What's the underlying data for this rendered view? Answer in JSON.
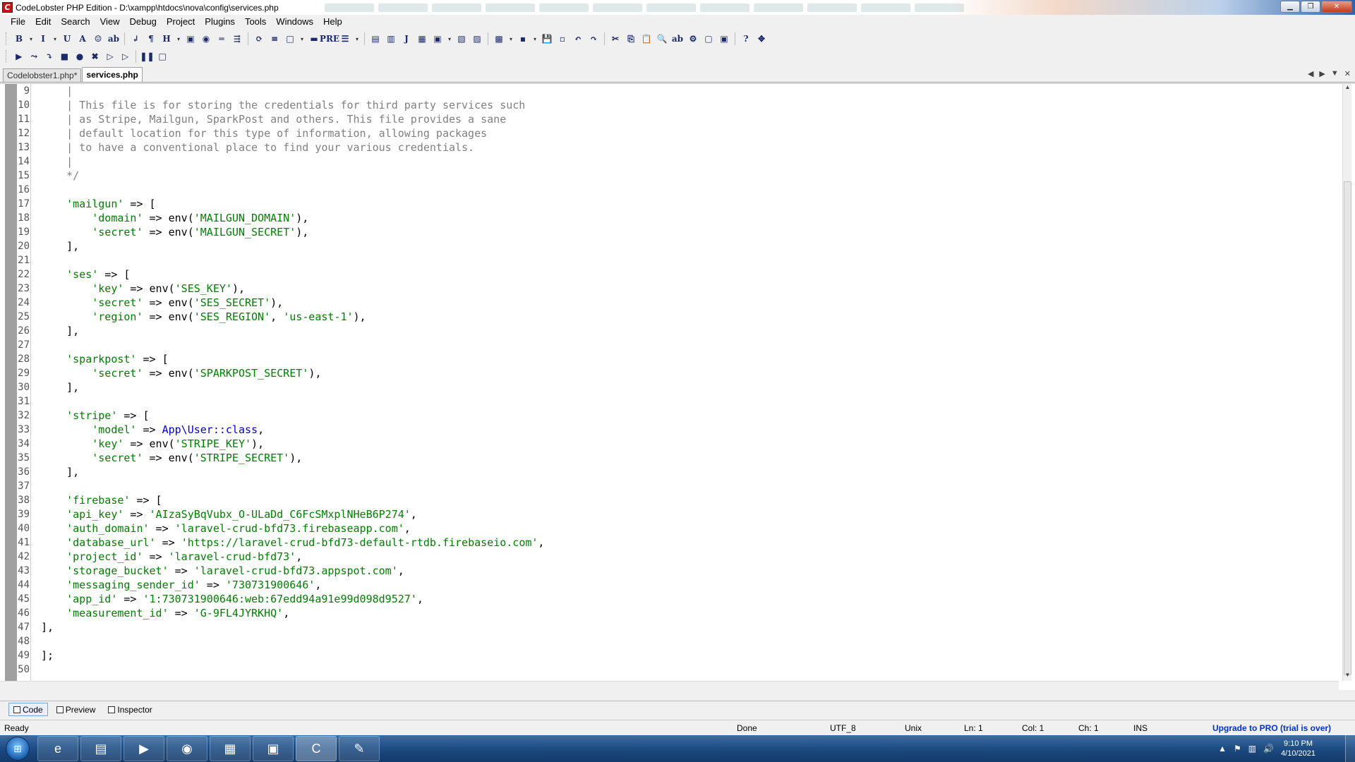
{
  "window": {
    "title": "CodeLobster PHP Edition - D:\\xampp\\htdocs\\nova\\config\\services.php",
    "app_icon": "C",
    "minimize": "▁",
    "maximize": "❐",
    "close": "✕"
  },
  "menu": [
    "File",
    "Edit",
    "Search",
    "View",
    "Debug",
    "Project",
    "Plugins",
    "Tools",
    "Windows",
    "Help"
  ],
  "toolbar1": [
    "B",
    "▾",
    "I",
    "▾",
    "U",
    "A",
    "☺",
    "ab",
    "↲",
    "¶",
    "H",
    "▾",
    "▣",
    "◉",
    "═",
    "⇶",
    "⟳",
    "≡",
    "□",
    "▾",
    "▬",
    "PRE",
    "☰",
    "▾",
    "▤",
    "▥",
    "J",
    "▦",
    "▣",
    "▾",
    "▧",
    "▨",
    "▩",
    "▾",
    "▪",
    "▾",
    "💾",
    "▫",
    "↶",
    "↷",
    "✂",
    "⎘",
    "📋",
    "🔍",
    "ab",
    "⚙",
    "▢",
    "▣",
    "?",
    "✥"
  ],
  "toolbar2": [
    "▶",
    "⤳",
    "⤵",
    "■",
    "●",
    "✖",
    "▷",
    "▷",
    "❚❚",
    "□"
  ],
  "tabs": {
    "items": [
      {
        "label": "Codelobster1.php*",
        "active": false
      },
      {
        "label": "services.php",
        "active": true
      }
    ],
    "nav_prev": "◀",
    "nav_next": "▶",
    "nav_list": "▼",
    "nav_close": "✕"
  },
  "code_lines": [
    {
      "n": "9",
      "parts": [
        {
          "t": "    |",
          "c": "cm"
        }
      ]
    },
    {
      "n": "10",
      "parts": [
        {
          "t": "    | This file is for storing the credentials for third party services such",
          "c": "cm"
        }
      ]
    },
    {
      "n": "11",
      "parts": [
        {
          "t": "    | as Stripe, Mailgun, SparkPost and others. This file provides a sane",
          "c": "cm"
        }
      ]
    },
    {
      "n": "12",
      "parts": [
        {
          "t": "    | default location for this type of information, allowing packages",
          "c": "cm"
        }
      ]
    },
    {
      "n": "13",
      "parts": [
        {
          "t": "    | to have a conventional place to find your various credentials.",
          "c": "cm"
        }
      ]
    },
    {
      "n": "14",
      "parts": [
        {
          "t": "    |",
          "c": "cm"
        }
      ]
    },
    {
      "n": "15",
      "parts": [
        {
          "t": "    */",
          "c": "cm"
        }
      ]
    },
    {
      "n": "16",
      "parts": []
    },
    {
      "n": "17",
      "parts": [
        {
          "t": "    ",
          "c": "op"
        },
        {
          "t": "'mailgun'",
          "c": "st"
        },
        {
          "t": " => [",
          "c": "op"
        }
      ]
    },
    {
      "n": "18",
      "parts": [
        {
          "t": "        ",
          "c": "op"
        },
        {
          "t": "'domain'",
          "c": "st"
        },
        {
          "t": " => env(",
          "c": "op"
        },
        {
          "t": "'MAILGUN_DOMAIN'",
          "c": "st"
        },
        {
          "t": "),",
          "c": "op"
        }
      ]
    },
    {
      "n": "19",
      "parts": [
        {
          "t": "        ",
          "c": "op"
        },
        {
          "t": "'secret'",
          "c": "st"
        },
        {
          "t": " => env(",
          "c": "op"
        },
        {
          "t": "'MAILGUN_SECRET'",
          "c": "st"
        },
        {
          "t": "),",
          "c": "op"
        }
      ]
    },
    {
      "n": "20",
      "parts": [
        {
          "t": "    ],",
          "c": "op"
        }
      ]
    },
    {
      "n": "21",
      "parts": []
    },
    {
      "n": "22",
      "parts": [
        {
          "t": "    ",
          "c": "op"
        },
        {
          "t": "'ses'",
          "c": "st"
        },
        {
          "t": " => [",
          "c": "op"
        }
      ]
    },
    {
      "n": "23",
      "parts": [
        {
          "t": "        ",
          "c": "op"
        },
        {
          "t": "'key'",
          "c": "st"
        },
        {
          "t": " => env(",
          "c": "op"
        },
        {
          "t": "'SES_KEY'",
          "c": "st"
        },
        {
          "t": "),",
          "c": "op"
        }
      ]
    },
    {
      "n": "24",
      "parts": [
        {
          "t": "        ",
          "c": "op"
        },
        {
          "t": "'secret'",
          "c": "st"
        },
        {
          "t": " => env(",
          "c": "op"
        },
        {
          "t": "'SES_SECRET'",
          "c": "st"
        },
        {
          "t": "),",
          "c": "op"
        }
      ]
    },
    {
      "n": "25",
      "parts": [
        {
          "t": "        ",
          "c": "op"
        },
        {
          "t": "'region'",
          "c": "st"
        },
        {
          "t": " => env(",
          "c": "op"
        },
        {
          "t": "'SES_REGION'",
          "c": "st"
        },
        {
          "t": ", ",
          "c": "op"
        },
        {
          "t": "'us-east-1'",
          "c": "st"
        },
        {
          "t": "),",
          "c": "op"
        }
      ]
    },
    {
      "n": "26",
      "parts": [
        {
          "t": "    ],",
          "c": "op"
        }
      ]
    },
    {
      "n": "27",
      "parts": []
    },
    {
      "n": "28",
      "parts": [
        {
          "t": "    ",
          "c": "op"
        },
        {
          "t": "'sparkpost'",
          "c": "st"
        },
        {
          "t": " => [",
          "c": "op"
        }
      ]
    },
    {
      "n": "29",
      "parts": [
        {
          "t": "        ",
          "c": "op"
        },
        {
          "t": "'secret'",
          "c": "st"
        },
        {
          "t": " => env(",
          "c": "op"
        },
        {
          "t": "'SPARKPOST_SECRET'",
          "c": "st"
        },
        {
          "t": "),",
          "c": "op"
        }
      ]
    },
    {
      "n": "30",
      "parts": [
        {
          "t": "    ],",
          "c": "op"
        }
      ]
    },
    {
      "n": "31",
      "parts": []
    },
    {
      "n": "32",
      "parts": [
        {
          "t": "    ",
          "c": "op"
        },
        {
          "t": "'stripe'",
          "c": "st"
        },
        {
          "t": " => [",
          "c": "op"
        }
      ]
    },
    {
      "n": "33",
      "parts": [
        {
          "t": "        ",
          "c": "op"
        },
        {
          "t": "'model'",
          "c": "st"
        },
        {
          "t": " => ",
          "c": "op"
        },
        {
          "t": "App\\User::class",
          "c": "cl"
        },
        {
          "t": ",",
          "c": "op"
        }
      ]
    },
    {
      "n": "34",
      "parts": [
        {
          "t": "        ",
          "c": "op"
        },
        {
          "t": "'key'",
          "c": "st"
        },
        {
          "t": " => env(",
          "c": "op"
        },
        {
          "t": "'STRIPE_KEY'",
          "c": "st"
        },
        {
          "t": "),",
          "c": "op"
        }
      ]
    },
    {
      "n": "35",
      "parts": [
        {
          "t": "        ",
          "c": "op"
        },
        {
          "t": "'secret'",
          "c": "st"
        },
        {
          "t": " => env(",
          "c": "op"
        },
        {
          "t": "'STRIPE_SECRET'",
          "c": "st"
        },
        {
          "t": "),",
          "c": "op"
        }
      ]
    },
    {
      "n": "36",
      "parts": [
        {
          "t": "    ],",
          "c": "op"
        }
      ]
    },
    {
      "n": "37",
      "parts": []
    },
    {
      "n": "38",
      "parts": [
        {
          "t": "    ",
          "c": "op"
        },
        {
          "t": "'firebase'",
          "c": "st"
        },
        {
          "t": " => [",
          "c": "op"
        }
      ]
    },
    {
      "n": "39",
      "parts": [
        {
          "t": "    ",
          "c": "op"
        },
        {
          "t": "'api_key'",
          "c": "st"
        },
        {
          "t": " => ",
          "c": "op"
        },
        {
          "t": "'AIzaSyBqVubx_O-ULaDd_C6FcSMxplNHeB6P274'",
          "c": "st"
        },
        {
          "t": ",",
          "c": "op"
        }
      ]
    },
    {
      "n": "40",
      "parts": [
        {
          "t": "    ",
          "c": "op"
        },
        {
          "t": "'auth_domain'",
          "c": "st"
        },
        {
          "t": " => ",
          "c": "op"
        },
        {
          "t": "'laravel-crud-bfd73.firebaseapp.com'",
          "c": "st"
        },
        {
          "t": ",",
          "c": "op"
        }
      ]
    },
    {
      "n": "41",
      "parts": [
        {
          "t": "    ",
          "c": "op"
        },
        {
          "t": "'database_url'",
          "c": "st"
        },
        {
          "t": " => ",
          "c": "op"
        },
        {
          "t": "'https://laravel-crud-bfd73-default-rtdb.firebaseio.com'",
          "c": "st"
        },
        {
          "t": ",",
          "c": "op"
        }
      ]
    },
    {
      "n": "42",
      "parts": [
        {
          "t": "    ",
          "c": "op"
        },
        {
          "t": "'project_id'",
          "c": "st"
        },
        {
          "t": " => ",
          "c": "op"
        },
        {
          "t": "'laravel-crud-bfd73'",
          "c": "st"
        },
        {
          "t": ",",
          "c": "op"
        }
      ]
    },
    {
      "n": "43",
      "parts": [
        {
          "t": "    ",
          "c": "op"
        },
        {
          "t": "'storage_bucket'",
          "c": "st"
        },
        {
          "t": " => ",
          "c": "op"
        },
        {
          "t": "'laravel-crud-bfd73.appspot.com'",
          "c": "st"
        },
        {
          "t": ",",
          "c": "op"
        }
      ]
    },
    {
      "n": "44",
      "parts": [
        {
          "t": "    ",
          "c": "op"
        },
        {
          "t": "'messaging_sender_id'",
          "c": "st"
        },
        {
          "t": " => ",
          "c": "op"
        },
        {
          "t": "'730731900646'",
          "c": "st"
        },
        {
          "t": ",",
          "c": "op"
        }
      ]
    },
    {
      "n": "45",
      "parts": [
        {
          "t": "    ",
          "c": "op"
        },
        {
          "t": "'app_id'",
          "c": "st"
        },
        {
          "t": " => ",
          "c": "op"
        },
        {
          "t": "'1:730731900646:web:67edd94a91e99d098d9527'",
          "c": "st"
        },
        {
          "t": ",",
          "c": "op"
        }
      ]
    },
    {
      "n": "46",
      "parts": [
        {
          "t": "    ",
          "c": "op"
        },
        {
          "t": "'measurement_id'",
          "c": "st"
        },
        {
          "t": " => ",
          "c": "op"
        },
        {
          "t": "'G-9FL4JYRKHQ'",
          "c": "st"
        },
        {
          "t": ",",
          "c": "op"
        }
      ]
    },
    {
      "n": "47",
      "parts": [
        {
          "t": "],",
          "c": "op"
        }
      ]
    },
    {
      "n": "48",
      "parts": []
    },
    {
      "n": "49",
      "parts": [
        {
          "t": "];",
          "c": "op"
        }
      ]
    },
    {
      "n": "50",
      "parts": []
    }
  ],
  "bottom_tabs": [
    {
      "label": "Code",
      "active": true
    },
    {
      "label": "Preview",
      "active": false
    },
    {
      "label": "Inspector",
      "active": false
    }
  ],
  "status": {
    "ready": "Ready",
    "done": "Done",
    "encoding": "UTF_8",
    "line_ending": "Unix",
    "ln": "Ln: 1",
    "col": "Col: 1",
    "ch": "Ch: 1",
    "mode": "INS",
    "upgrade": "Upgrade to PRO (trial is over)"
  },
  "taskbar": {
    "start": "⊞",
    "apps": [
      {
        "name": "ie",
        "glyph": "e"
      },
      {
        "name": "explorer",
        "glyph": "▤"
      },
      {
        "name": "media-player",
        "glyph": "▶"
      },
      {
        "name": "chrome",
        "glyph": "◉"
      },
      {
        "name": "control-panel",
        "glyph": "▦"
      },
      {
        "name": "network",
        "glyph": "▣"
      },
      {
        "name": "codelobster",
        "glyph": "C"
      },
      {
        "name": "paint",
        "glyph": "✎"
      }
    ],
    "tray_arrow": "▲",
    "time": "9:10 PM",
    "date": "4/10/2021"
  },
  "colors": {
    "comment": "#808080",
    "string": "#008000",
    "class": "#0000cc",
    "upgrade": "#0033cc"
  }
}
